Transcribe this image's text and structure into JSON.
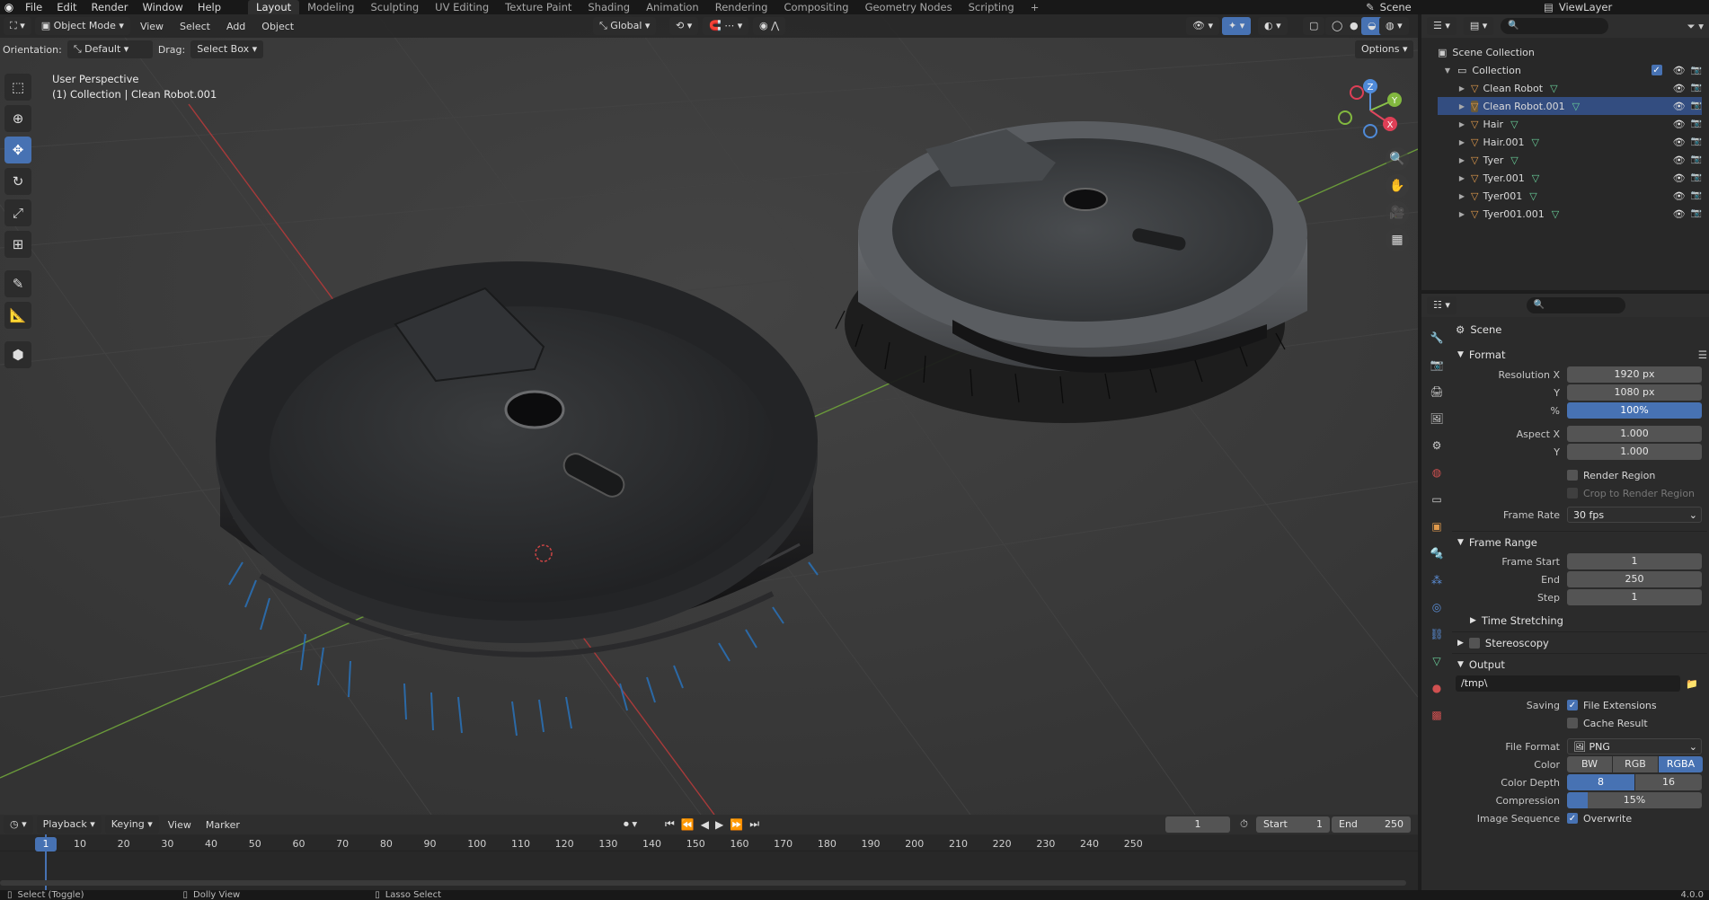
{
  "topbar": {
    "menus": [
      "File",
      "Edit",
      "Render",
      "Window",
      "Help"
    ],
    "workspaces": [
      "Layout",
      "Modeling",
      "Sculpting",
      "UV Editing",
      "Texture Paint",
      "Shading",
      "Animation",
      "Rendering",
      "Compositing",
      "Geometry Nodes",
      "Scripting"
    ],
    "add_tab": "+",
    "scene": "Scene",
    "view_layer": "ViewLayer"
  },
  "viewport_header": {
    "mode": "Object Mode",
    "menus": [
      "View",
      "Select",
      "Add",
      "Object"
    ],
    "transform": "Global"
  },
  "viewport_tools": {
    "orientation_label": "Orientation:",
    "orientation_value": "Default",
    "drag_label": "Drag:",
    "drag_value": "Select Box",
    "options": "Options"
  },
  "viewport_info": {
    "perspective": "User Perspective",
    "collection": "(1) Collection | Clean Robot.001"
  },
  "gizmo": {
    "x": "X",
    "y": "Y",
    "z": "Z"
  },
  "outliner": {
    "root": "Scene Collection",
    "collection": "Collection",
    "items": [
      "Clean Robot",
      "Clean Robot.001",
      "Hair",
      "Hair.001",
      "Tyer",
      "Tyer.001",
      "Tyer001",
      "Tyer001.001"
    ]
  },
  "properties": {
    "context": "Scene",
    "format": {
      "title": "Format",
      "res_x_label": "Resolution X",
      "res_x": "1920 px",
      "res_y_label": "Y",
      "res_y": "1080 px",
      "pct_label": "%",
      "pct": "100%",
      "aspect_x_label": "Aspect X",
      "aspect_x": "1.000",
      "aspect_y_label": "Y",
      "aspect_y": "1.000",
      "render_region": "Render Region",
      "crop_region": "Crop to Render Region",
      "frame_rate_label": "Frame Rate",
      "frame_rate": "30 fps"
    },
    "frame_range": {
      "title": "Frame Range",
      "start_label": "Frame Start",
      "start": "1",
      "end_label": "End",
      "end": "250",
      "step_label": "Step",
      "step": "1"
    },
    "time_stretching": "Time Stretching",
    "stereoscopy": "Stereoscopy",
    "output": {
      "title": "Output",
      "path": "/tmp\\",
      "saving_label": "Saving",
      "file_extensions": "File Extensions",
      "cache_result": "Cache Result",
      "file_format_label": "File Format",
      "file_format": "PNG",
      "color_label": "Color",
      "color_options": [
        "BW",
        "RGB",
        "RGBA"
      ],
      "depth_label": "Color Depth",
      "depth_options": [
        "8",
        "16"
      ],
      "compression_label": "Compression",
      "compression": "15%",
      "compression_fraction": 0.15,
      "sequence_label": "Image Sequence",
      "overwrite": "Overwrite"
    }
  },
  "timeline": {
    "menus": [
      "Playback",
      "Keying",
      "View",
      "Marker"
    ],
    "current_frame": "1",
    "start_label": "Start",
    "start": "1",
    "end_label": "End",
    "end": "250",
    "ruler": [
      "10",
      "20",
      "30",
      "40",
      "50",
      "60",
      "70",
      "80",
      "90",
      "100",
      "110",
      "120",
      "130",
      "140",
      "150",
      "160",
      "170",
      "180",
      "190",
      "200",
      "210",
      "220",
      "230",
      "240",
      "250"
    ],
    "playhead_frame": "1"
  },
  "statusbar": {
    "hint1": "Select (Toggle)",
    "hint2": "Dolly View",
    "hint3": "Lasso Select",
    "version": "4.0.0"
  },
  "colors": {
    "accent": "#4772b3",
    "object_icon": "#e09a4c",
    "mesh_icon": "#6ad09a"
  }
}
